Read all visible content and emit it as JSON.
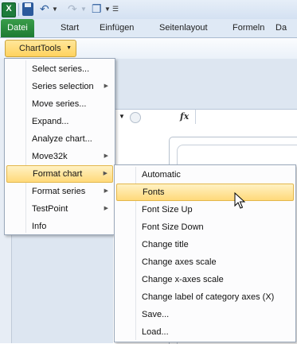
{
  "toolbar": {
    "app_icon_letter": "X",
    "icons": [
      "excel-icon",
      "save-icon",
      "undo-icon",
      "redo-icon",
      "window-icon",
      "customize-qat-icon"
    ]
  },
  "ribbon": {
    "tabs": [
      "Datei",
      "Start",
      "Einfügen",
      "Seitenlayout",
      "Formeln",
      "Da"
    ],
    "file_tab_color": "#2a8c3f",
    "charttools_label": "ChartTools"
  },
  "formula_bar": {
    "fx_label": "fx"
  },
  "menu_main": {
    "items": [
      {
        "label": "Select series...",
        "has_submenu": false
      },
      {
        "label": "Series selection",
        "has_submenu": true
      },
      {
        "label": "Move series...",
        "has_submenu": false
      },
      {
        "label": "Expand...",
        "has_submenu": false
      },
      {
        "label": "Analyze chart...",
        "has_submenu": false
      },
      {
        "label": "Move32k",
        "has_submenu": true
      },
      {
        "label": "Format chart",
        "has_submenu": true,
        "highlighted": true
      },
      {
        "label": "Format series",
        "has_submenu": true
      },
      {
        "label": "TestPoint",
        "has_submenu": true
      },
      {
        "label": "Info",
        "has_submenu": false
      }
    ]
  },
  "menu_sub": {
    "items": [
      {
        "label": "Automatic"
      },
      {
        "label": "Fonts",
        "highlighted": true
      },
      {
        "label": "Font Size Up"
      },
      {
        "label": "Font Size Down"
      },
      {
        "label": "Change title"
      },
      {
        "label": "Change axes scale"
      },
      {
        "label": "Change x-axes scale"
      },
      {
        "label": "Change label of category axes (X)"
      },
      {
        "label": "Save..."
      },
      {
        "label": "Load..."
      }
    ]
  },
  "colors": {
    "highlight_top": "#fff2c4",
    "highlight_bottom": "#ffd97a",
    "ribbon_bg": "#dfe9f5"
  }
}
